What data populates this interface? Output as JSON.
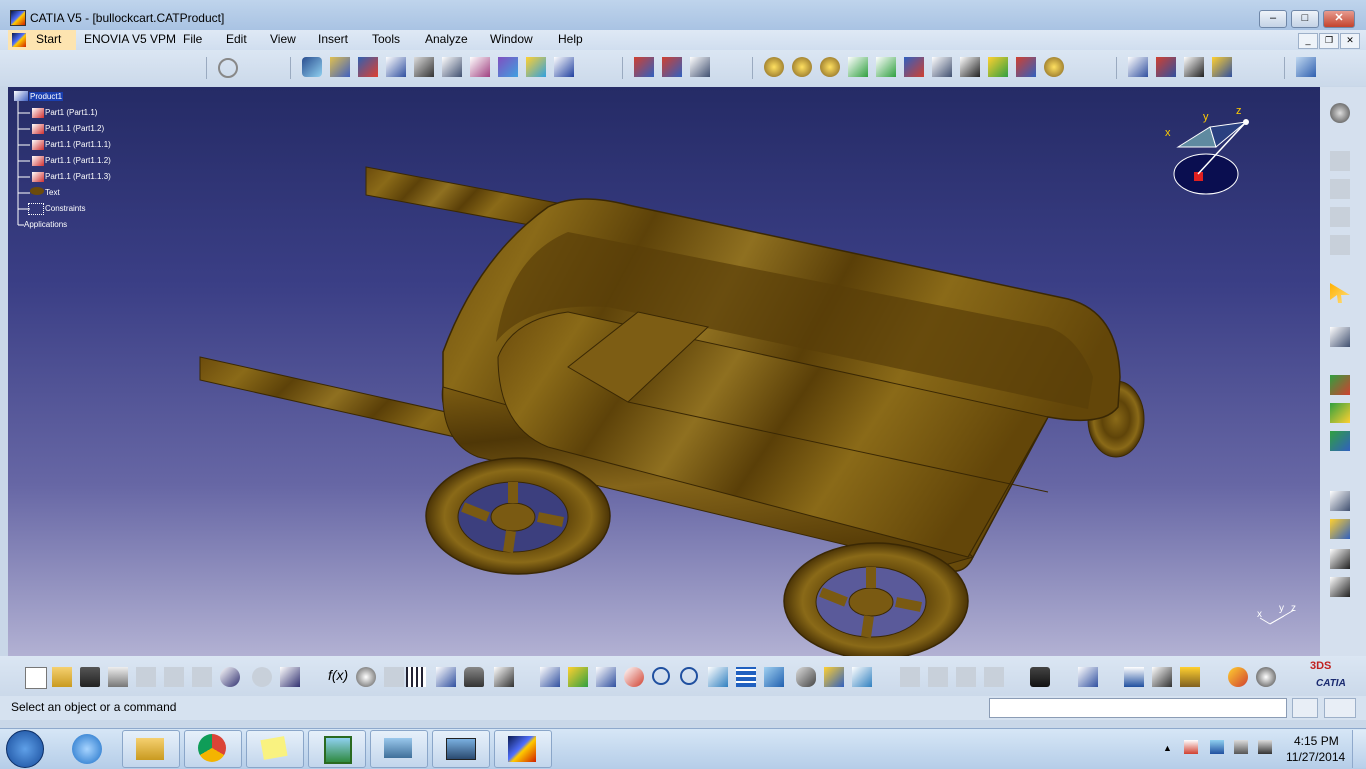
{
  "window": {
    "title": "CATIA V5 - [bullockcart.CATProduct]",
    "min": "–",
    "max": "□",
    "close": "✕"
  },
  "menu": {
    "items": [
      "Start",
      "ENOVIA V5 VPM",
      "File",
      "Edit",
      "View",
      "Insert",
      "Tools",
      "Analyze",
      "Window",
      "Help"
    ]
  },
  "tree": {
    "root": "Product1",
    "items": [
      "Part1 (Part1.1)",
      "Part1.1 (Part1.2)",
      "Part1.1 (Part1.1.1)",
      "Part1.1 (Part1.1.2)",
      "Part1.1 (Part1.1.3)",
      "Text",
      "Constraints",
      "Applications"
    ]
  },
  "compass": {
    "x": "x",
    "y": "y",
    "z": "z"
  },
  "axis_triad": {
    "x": "x",
    "y": "y",
    "z": "z"
  },
  "status": {
    "message": "Select an object or a command",
    "input": ""
  },
  "brand": {
    "catia": "CATIA",
    "ds": "3DS"
  },
  "taskbar": {
    "time": "4:15 PM",
    "date": "11/27/2014"
  },
  "colors": {
    "viewport_top": "#252b66",
    "viewport_bottom": "#b2b1d3",
    "wood": "#7a5a10",
    "wood_dark": "#4a3508"
  }
}
